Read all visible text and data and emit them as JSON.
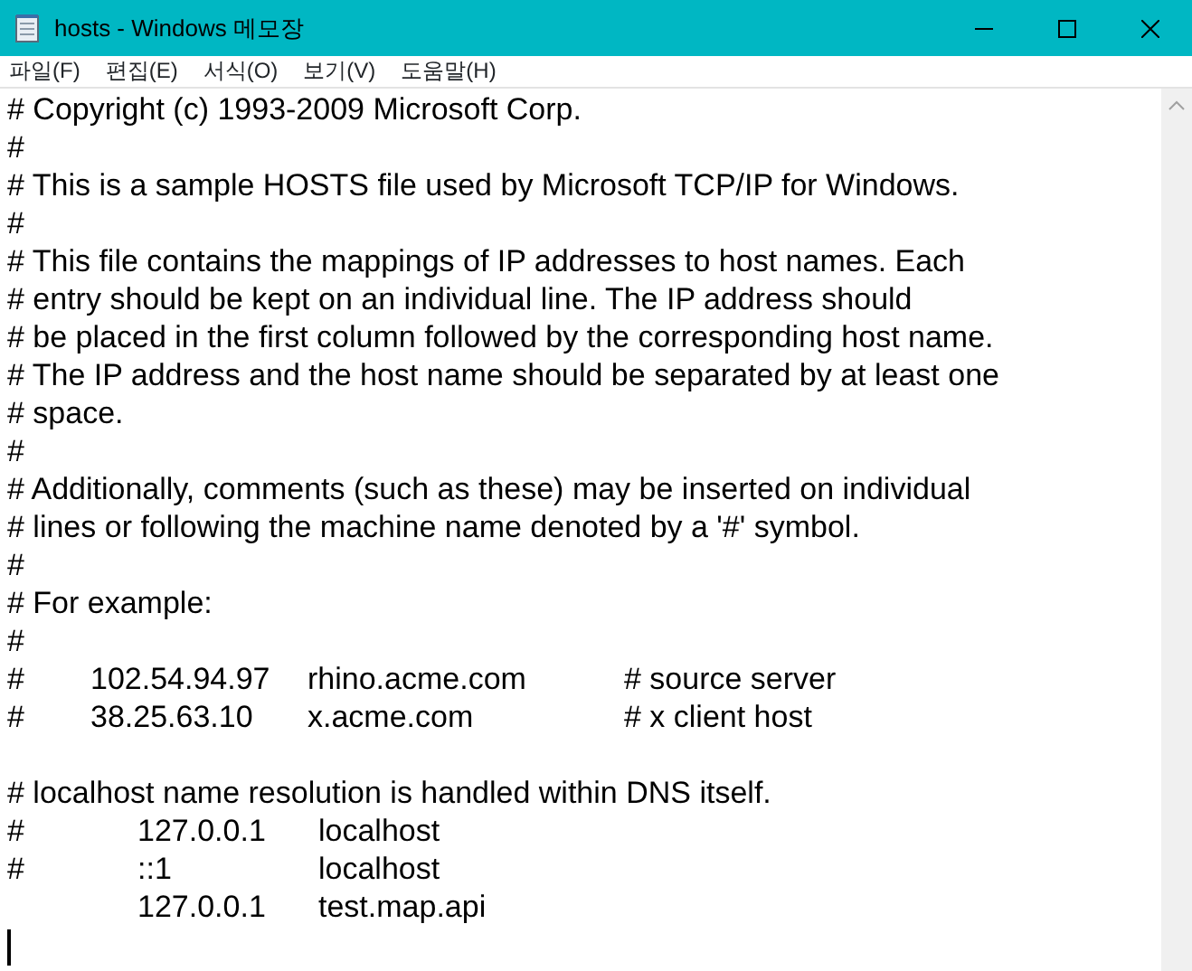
{
  "window": {
    "title": "hosts - Windows 메모장"
  },
  "menu": [
    "파일(F)",
    "편집(E)",
    "서식(O)",
    "보기(V)",
    "도움말(H)"
  ],
  "lines": [
    {
      "kind": "text",
      "text": "# Copyright (c) 1993-2009 Microsoft Corp."
    },
    {
      "kind": "text",
      "text": "#"
    },
    {
      "kind": "text",
      "text": "# This is a sample HOSTS file used by Microsoft TCP/IP for Windows."
    },
    {
      "kind": "text",
      "text": "#"
    },
    {
      "kind": "text",
      "text": "# This file contains the mappings of IP addresses to host names. Each"
    },
    {
      "kind": "text",
      "text": "# entry should be kept on an individual line. The IP address should"
    },
    {
      "kind": "text",
      "text": "# be placed in the first column followed by the corresponding host name."
    },
    {
      "kind": "text",
      "text": "# The IP address and the host name should be separated by at least one"
    },
    {
      "kind": "text",
      "text": "# space."
    },
    {
      "kind": "text",
      "text": "#"
    },
    {
      "kind": "text",
      "text": "# Additionally, comments (such as these) may be inserted on individual"
    },
    {
      "kind": "text",
      "text": "# lines or following the machine name denoted by a '#' symbol."
    },
    {
      "kind": "text",
      "text": "#"
    },
    {
      "kind": "text",
      "text": "# For example:"
    },
    {
      "kind": "text",
      "text": "#"
    },
    {
      "kind": "example",
      "parts": [
        "#",
        "102.54.94.97",
        "rhino.acme.com",
        "# source server"
      ]
    },
    {
      "kind": "example",
      "parts": [
        "#",
        "38.25.63.10",
        "x.acme.com",
        "# x client host"
      ]
    },
    {
      "kind": "blank"
    },
    {
      "kind": "text",
      "text": "# localhost name resolution is handled within DNS itself."
    },
    {
      "kind": "entry",
      "marker": "#",
      "address": "127.0.0.1",
      "host": "localhost"
    },
    {
      "kind": "entry",
      "marker": "#",
      "address": "::1",
      "host": "localhost"
    },
    {
      "kind": "entry",
      "address": "127.0.0.1",
      "host": "test.map.api"
    }
  ]
}
